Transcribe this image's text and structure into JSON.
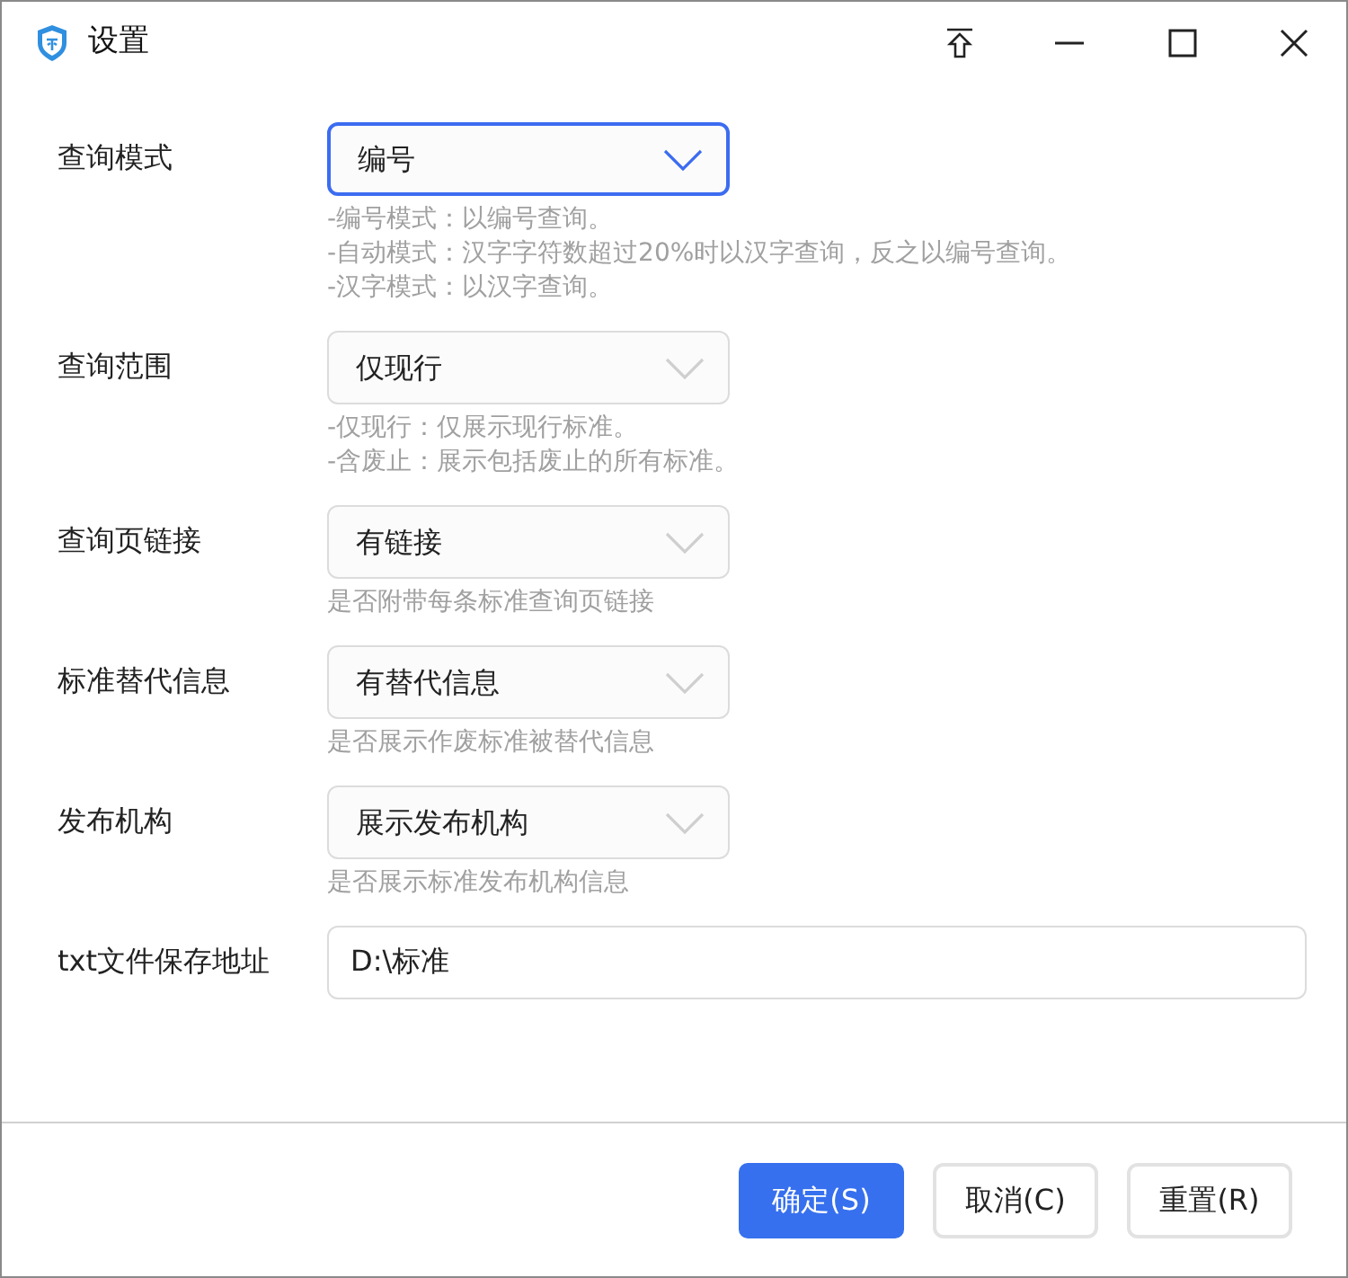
{
  "window": {
    "title": "设置"
  },
  "settings": [
    {
      "label": "查询模式",
      "kind": "select",
      "value": "编号",
      "focused": true,
      "hints": [
        "-编号模式：以编号查询。",
        "-自动模式：汉字字符数超过20%时以汉字查询，反之以编号查询。",
        "-汉字模式：以汉字查询。"
      ]
    },
    {
      "label": "查询范围",
      "kind": "select",
      "value": "仅现行",
      "focused": false,
      "hints": [
        "-仅现行：仅展示现行标准。",
        "-含废止：展示包括废止的所有标准。"
      ]
    },
    {
      "label": "查询页链接",
      "kind": "select",
      "value": "有链接",
      "focused": false,
      "hints": [
        "是否附带每条标准查询页链接"
      ]
    },
    {
      "label": "标准替代信息",
      "kind": "select",
      "value": "有替代信息",
      "focused": false,
      "hints": [
        "是否展示作废标准被替代信息"
      ]
    },
    {
      "label": "发布机构",
      "kind": "select",
      "value": "展示发布机构",
      "focused": false,
      "hints": [
        "是否展示标准发布机构信息"
      ]
    },
    {
      "label": "txt文件保存地址",
      "kind": "text",
      "value": "D:\\标准"
    }
  ],
  "buttons": [
    {
      "label": "确定(S)",
      "primary": true
    },
    {
      "label": "取消(C)",
      "primary": false
    },
    {
      "label": "重置(R)",
      "primary": false
    }
  ]
}
